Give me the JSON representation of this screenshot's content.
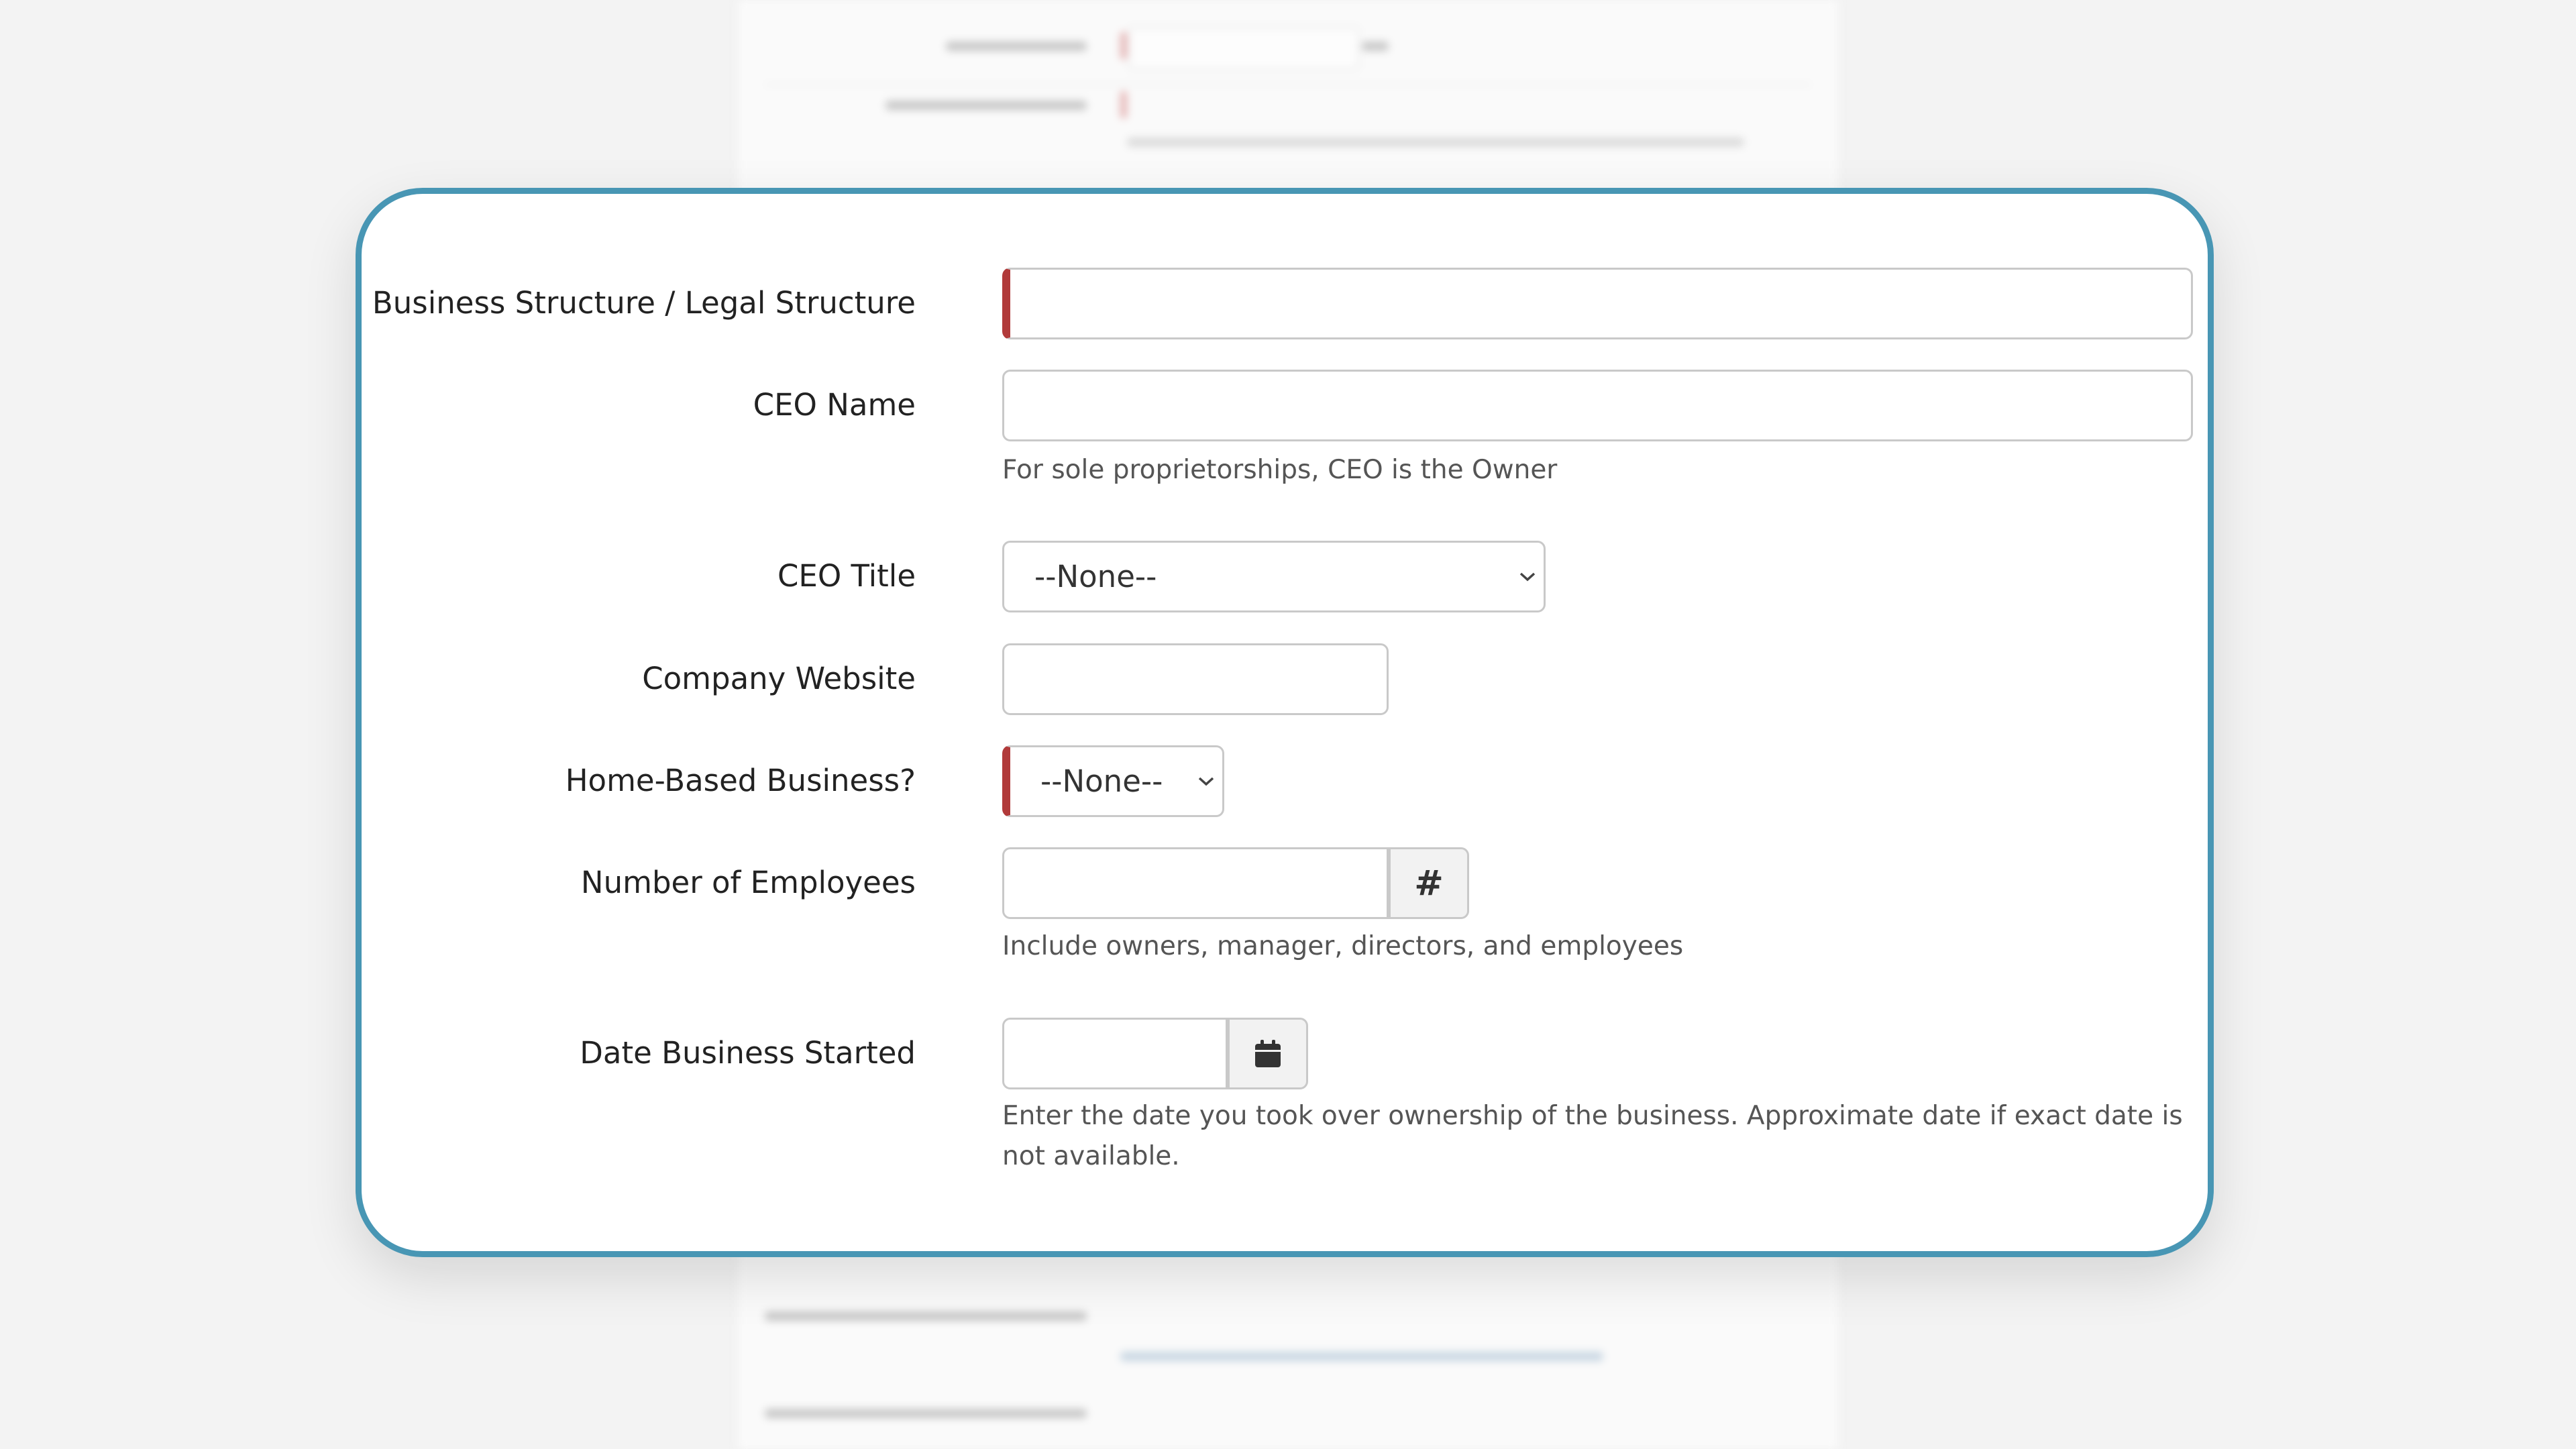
{
  "form": {
    "fields": [
      {
        "label": "Business Structure / Legal Structure",
        "value": "",
        "required": true
      },
      {
        "label": "CEO Name",
        "value": "",
        "help": "For sole proprietorships, CEO is the Owner"
      },
      {
        "label": "CEO Title",
        "selected": "--None--"
      },
      {
        "label": "Company Website",
        "value": ""
      },
      {
        "label": "Home-Based Business?",
        "selected": "--None--",
        "required": true
      },
      {
        "label": "Number of Employees",
        "value": "",
        "addon": "#",
        "help": "Include owners, manager, directors, and employees"
      },
      {
        "label": "Date Business Started",
        "value": "",
        "help": "Enter the date you took over ownership of the business. Approximate date if exact date is not available."
      }
    ]
  },
  "icons": {
    "calendar": "calendar-icon",
    "chevron": "chevron-down-icon"
  },
  "colors": {
    "card_border": "#4896b4",
    "required_marker": "#b13a3a"
  }
}
